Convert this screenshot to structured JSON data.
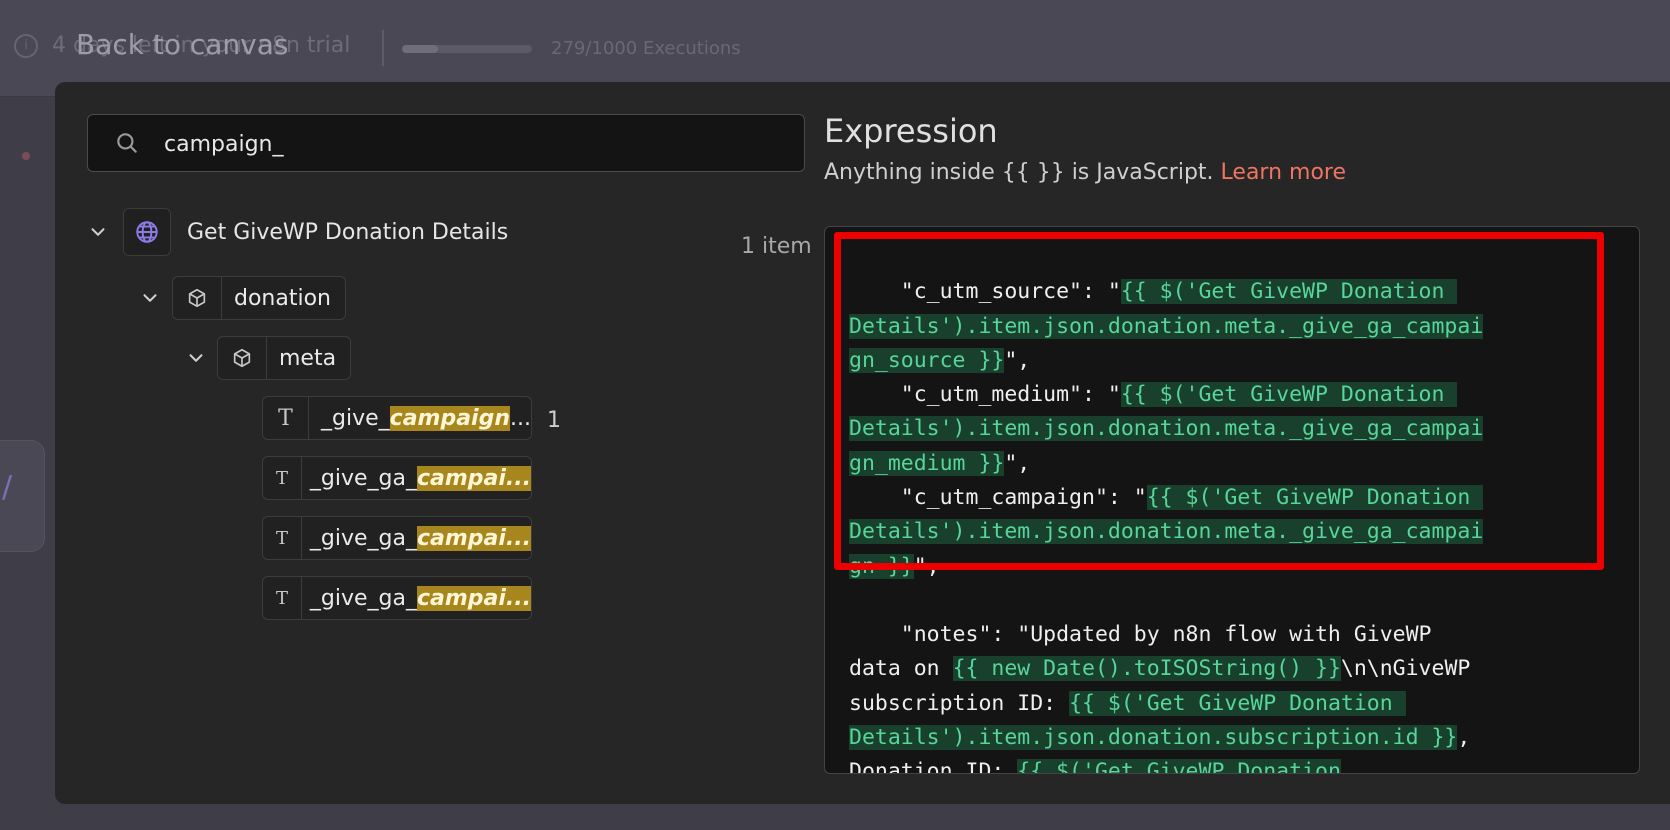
{
  "backdrop": {
    "trial_text": "4 days left in your n8n trial",
    "executions_text": "279/1000 Executions",
    "executions_fraction": 0.279
  },
  "back_link": "Back to canvas",
  "search": {
    "value": "campaign_",
    "placeholder": "Search"
  },
  "tree": {
    "node_title": "Get GiveWP Donation Details",
    "item_count": "1 item",
    "donation_label": "donation",
    "meta_label": "meta",
    "keys": [
      {
        "prefix": "_give_",
        "match": "campaign",
        "suffix": "..."
      },
      {
        "prefix": "_give_ga_",
        "match": "campai",
        "suffix": "..."
      },
      {
        "prefix": "_give_ga_",
        "match": "campai",
        "suffix": "..."
      },
      {
        "prefix": "_give_ga_",
        "match": "campai",
        "suffix": "..."
      }
    ],
    "first_key_count": "1"
  },
  "expression": {
    "title": "Expression",
    "hint": "Anything inside {{ }} is JavaScript.",
    "learn_more": "Learn more"
  },
  "code": {
    "l1a": "    \"c_utm_source\": \"",
    "l1e": "{{ $('Get GiveWP Donation ",
    "l2e": "Details').item.json.donation.meta._give_ga_campai",
    "l3e": "gn_source }}",
    "l3b": "\",",
    "l4a": "    \"c_utm_medium\": \"",
    "l4e": "{{ $('Get GiveWP Donation ",
    "l5e": "Details').item.json.donation.meta._give_ga_campai",
    "l6e": "gn_medium }}",
    "l6b": "\",",
    "l7a": "    \"c_utm_campaign\": \"",
    "l7e": "{{ $('Get GiveWP Donation ",
    "l8e": "Details').item.json.donation.meta._give_ga_campai",
    "l9e": "gn }}",
    "l9b": "\",",
    "l10a": "    \"notes\": \"Updated by n8n flow with GiveWP",
    "l11a": "data on ",
    "l11e": "{{ new Date().toISOString() }}",
    "l11b": "\\n\\nGiveWP",
    "l12a": "subscription ID: ",
    "l12e": "{{ $('Get GiveWP Donation ",
    "l13e": "Details').item.json.donation.subscription.id }}",
    "l13b": ",",
    "l14a": "Donation ID: ",
    "l14e": "{{ $('Get GiveWP Donation"
  },
  "colors": {
    "expression_bg": "#19402c",
    "expression_text": "#57d59a",
    "highlight": "#a8861e",
    "annotation_frame": "#ee0000",
    "learn_more": "#ef7461"
  }
}
